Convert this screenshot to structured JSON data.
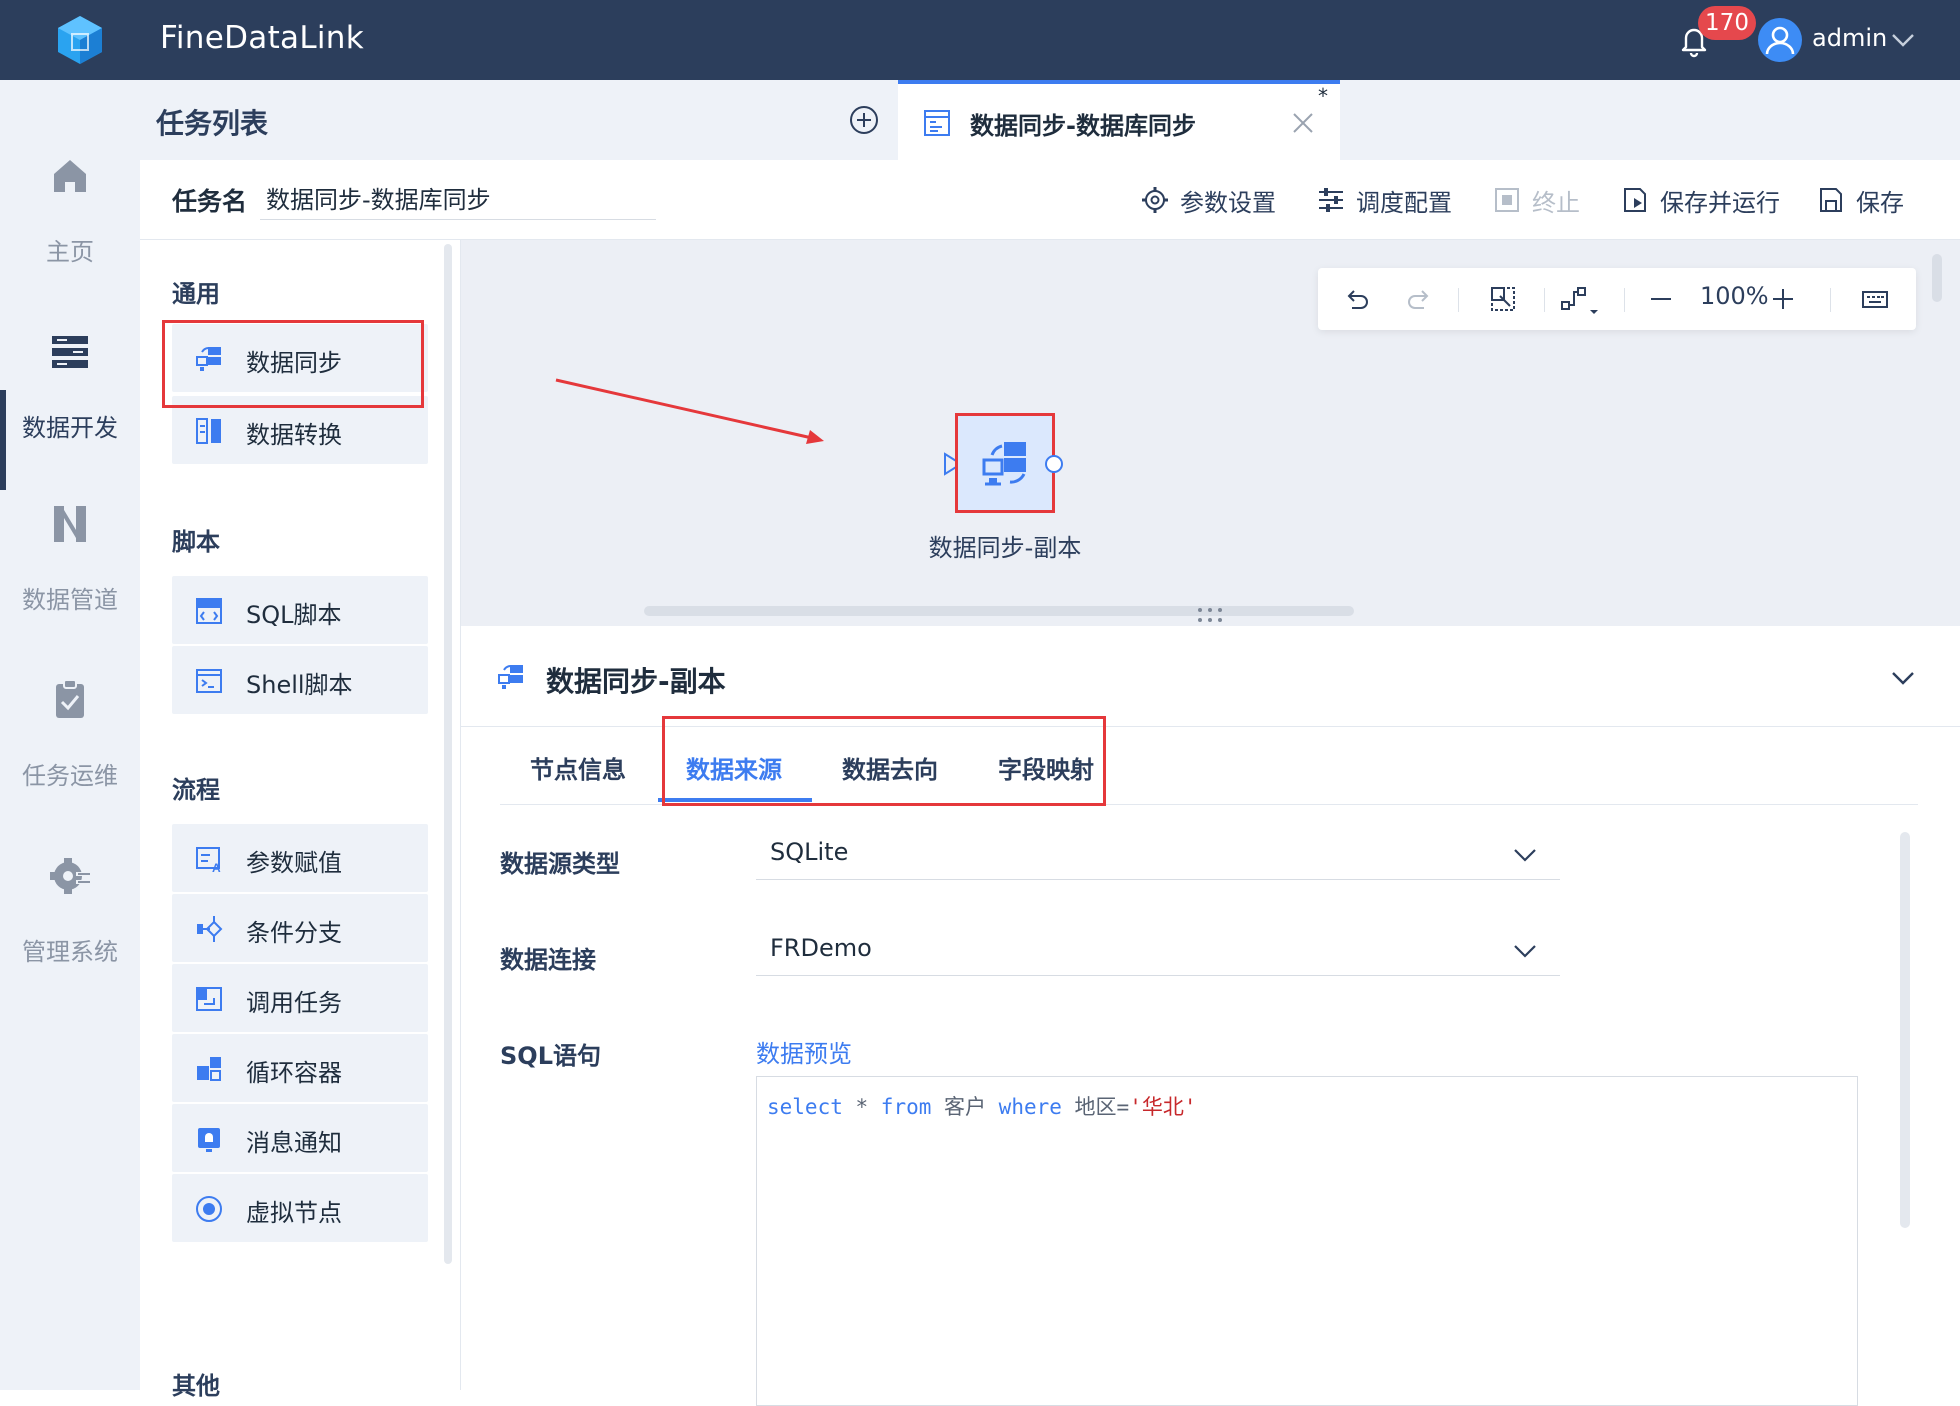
{
  "app": {
    "title": "FineDataLink",
    "notification_count": "170",
    "username": "admin"
  },
  "colors": {
    "topbar": "#2c3e5c",
    "accent": "#3d7cf0",
    "highlight": "#e5383b",
    "badge": "#e5484d",
    "sidebar_bg": "#eef2f8",
    "canvas_bg": "#eceff5"
  },
  "leftnav": [
    {
      "label": "主页",
      "icon": "home-icon"
    },
    {
      "label": "数据开发",
      "icon": "data-dev-icon",
      "active": true
    },
    {
      "label": "数据管道",
      "icon": "pipeline-icon"
    },
    {
      "label": "任务运维",
      "icon": "task-ops-icon"
    },
    {
      "label": "管理系统",
      "icon": "settings-gear-icon"
    }
  ],
  "tasklist": {
    "title": "任务列表"
  },
  "tab": {
    "label": "数据同步-数据库同步",
    "modified_mark": "*"
  },
  "task": {
    "name_label": "任务名",
    "name_value": "数据同步-数据库同步"
  },
  "toolbar": {
    "params": "参数设置",
    "schedule": "调度配置",
    "stop": "终止",
    "save_run": "保存并运行",
    "save": "保存"
  },
  "palette": {
    "groups": {
      "general": "通用",
      "script": "脚本",
      "flow": "流程",
      "other": "其他"
    },
    "items": {
      "data_sync": "数据同步",
      "data_transform": "数据转换",
      "sql_script": "SQL脚本",
      "shell_script": "Shell脚本",
      "param_assign": "参数赋值",
      "condition_branch": "条件分支",
      "call_task": "调用任务",
      "loop_container": "循环容器",
      "message_notify": "消息通知",
      "virtual_node": "虚拟节点"
    }
  },
  "canvas": {
    "zoom": "100%",
    "node_label": "数据同步-副本"
  },
  "detail": {
    "title": "数据同步-副本",
    "tabs": [
      "节点信息",
      "数据来源",
      "数据去向",
      "字段映射"
    ],
    "active_tab": "数据来源",
    "fields": {
      "source_type_label": "数据源类型",
      "source_type_value": "SQLite",
      "connection_label": "数据连接",
      "connection_value": "FRDemo",
      "sql_label": "SQL语句",
      "preview_link": "数据预览"
    },
    "sql": {
      "kw_select": "select",
      "star": " * ",
      "kw_from": "from",
      "table": " 客户 ",
      "kw_where": "where",
      "column": " 地区=",
      "literal": "'华北'"
    }
  }
}
